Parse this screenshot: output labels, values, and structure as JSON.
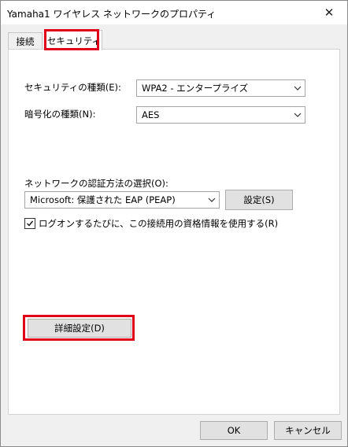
{
  "window": {
    "title": "Yamaha1 ワイヤレス ネットワークのプロパティ",
    "close_label": "✕"
  },
  "tabs": [
    {
      "label": "接続",
      "active": false
    },
    {
      "label": "セキュリティ",
      "active": true
    }
  ],
  "security": {
    "security_type_label": "セキュリティの種類(E):",
    "security_type_value": "WPA2 - エンタープライズ",
    "encryption_type_label": "暗号化の種類(N):",
    "encryption_type_value": "AES",
    "auth_method_label": "ネットワークの認証方法の選択(O):",
    "auth_method_value": "Microsoft: 保護された EAP (PEAP)",
    "settings_button": "設定(S)",
    "remember_checkbox_label": "ログオンするたびに、この接続用の資格情報を使用する(R)",
    "remember_checked": true,
    "advanced_button": "詳細設定(D)"
  },
  "footer": {
    "ok_button": "OK",
    "cancel_button": "キャンセル"
  },
  "colors": {
    "highlight": "#e0001a"
  }
}
